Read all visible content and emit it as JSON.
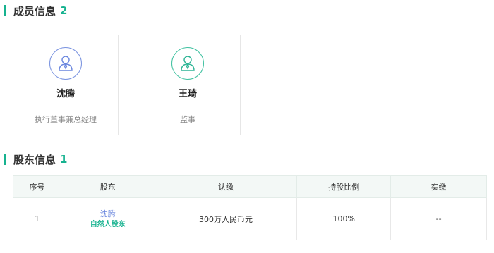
{
  "members_section": {
    "title": "成员信息",
    "count": "2"
  },
  "members": [
    {
      "name": "沈腾",
      "role": "执行董事兼总经理",
      "icon": "user-icon",
      "accent": "#6a86de"
    },
    {
      "name": "王琦",
      "role": "监事",
      "icon": "user-icon",
      "accent": "#2db495"
    }
  ],
  "shareholders_section": {
    "title": "股东信息",
    "count": "1"
  },
  "shareholder_table": {
    "headers": [
      "序号",
      "股东",
      "认缴",
      "持股比例",
      "实缴"
    ],
    "rows": [
      {
        "index": "1",
        "holder": "沈腾",
        "holder_type": "自然人股东",
        "subscribed": "300万人民币元",
        "ratio": "100%",
        "paid": "--"
      }
    ]
  },
  "colors": {
    "accent_green": "#16b28f",
    "link_blue": "#6a86de",
    "header_bg": "#f3f8f6"
  }
}
